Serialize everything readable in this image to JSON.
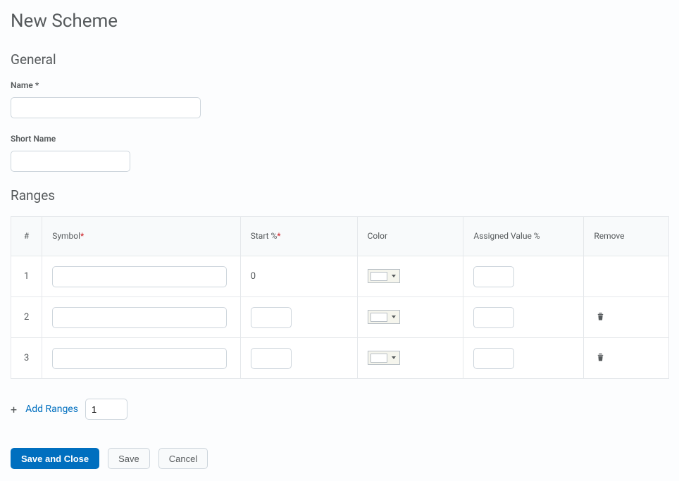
{
  "page": {
    "title": "New Scheme"
  },
  "general": {
    "heading": "General",
    "name_label": "Name",
    "name_required_mark": "*",
    "name_value": "",
    "short_name_label": "Short Name",
    "short_name_value": ""
  },
  "ranges": {
    "heading": "Ranges",
    "columns": {
      "num": "#",
      "symbol": "Symbol",
      "symbol_star": "*",
      "start": "Start %",
      "start_star": "*",
      "color": "Color",
      "assigned": "Assigned Value %",
      "remove": "Remove"
    },
    "rows": [
      {
        "num": "1",
        "symbol": "",
        "start_display": "0",
        "start_editable": false,
        "assigned": "",
        "removable": false
      },
      {
        "num": "2",
        "symbol": "",
        "start_value": "",
        "start_editable": true,
        "assigned": "",
        "removable": true
      },
      {
        "num": "3",
        "symbol": "",
        "start_value": "",
        "start_editable": true,
        "assigned": "",
        "removable": true
      }
    ]
  },
  "add_ranges": {
    "label": "Add Ranges",
    "count": "1"
  },
  "buttons": {
    "save_close": "Save and Close",
    "save": "Save",
    "cancel": "Cancel"
  }
}
